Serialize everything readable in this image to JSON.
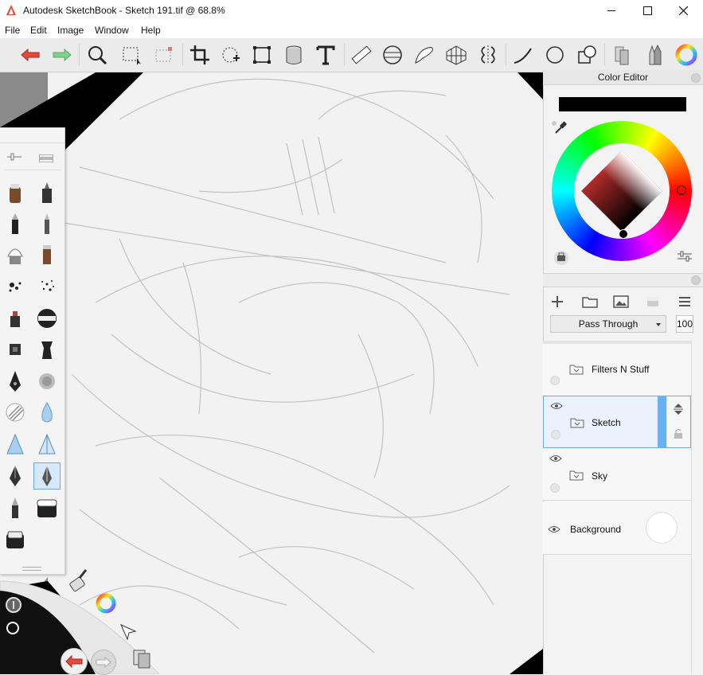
{
  "window": {
    "title": "Autodesk SketchBook - Sketch 191.tif @ 68.8%",
    "controls": [
      "minimize-icon",
      "maximize-icon",
      "close-icon"
    ]
  },
  "menu": [
    "File",
    "Edit",
    "Image",
    "Window",
    "Help"
  ],
  "toolbar": {
    "tools": [
      "undo-icon",
      "redo-icon",
      "zoom-icon",
      "select-icon",
      "transform-select-icon",
      "crop-icon",
      "distort-icon",
      "perspective-transform-icon",
      "fill-bucket-icon",
      "text-icon",
      "ruler-icon",
      "ellipse-guide-icon",
      "french-curve-icon",
      "perspective-grid-icon",
      "symmetry-icon",
      "stroke-tool-icon",
      "shape-tool-icon",
      "copic-icon",
      "layers-icon",
      "brushes-icon",
      "color-wheel-icon"
    ]
  },
  "color_editor": {
    "title": "Color Editor",
    "current_color": "#000000"
  },
  "layers": {
    "blend_mode": "Pass Through",
    "opacity": "100",
    "items": [
      {
        "name": "Filters N Stuff",
        "visible": false,
        "selected": false
      },
      {
        "name": "Sketch",
        "visible": true,
        "selected": true
      },
      {
        "name": "Sky",
        "visible": true,
        "selected": false
      },
      {
        "name": "Background",
        "visible": true,
        "selected": false
      }
    ]
  },
  "colors": {
    "accent": "#3a8ee6",
    "selection_bg": "#e9f2fd",
    "undo": "#e14b3b",
    "redo": "#7fd08a"
  }
}
